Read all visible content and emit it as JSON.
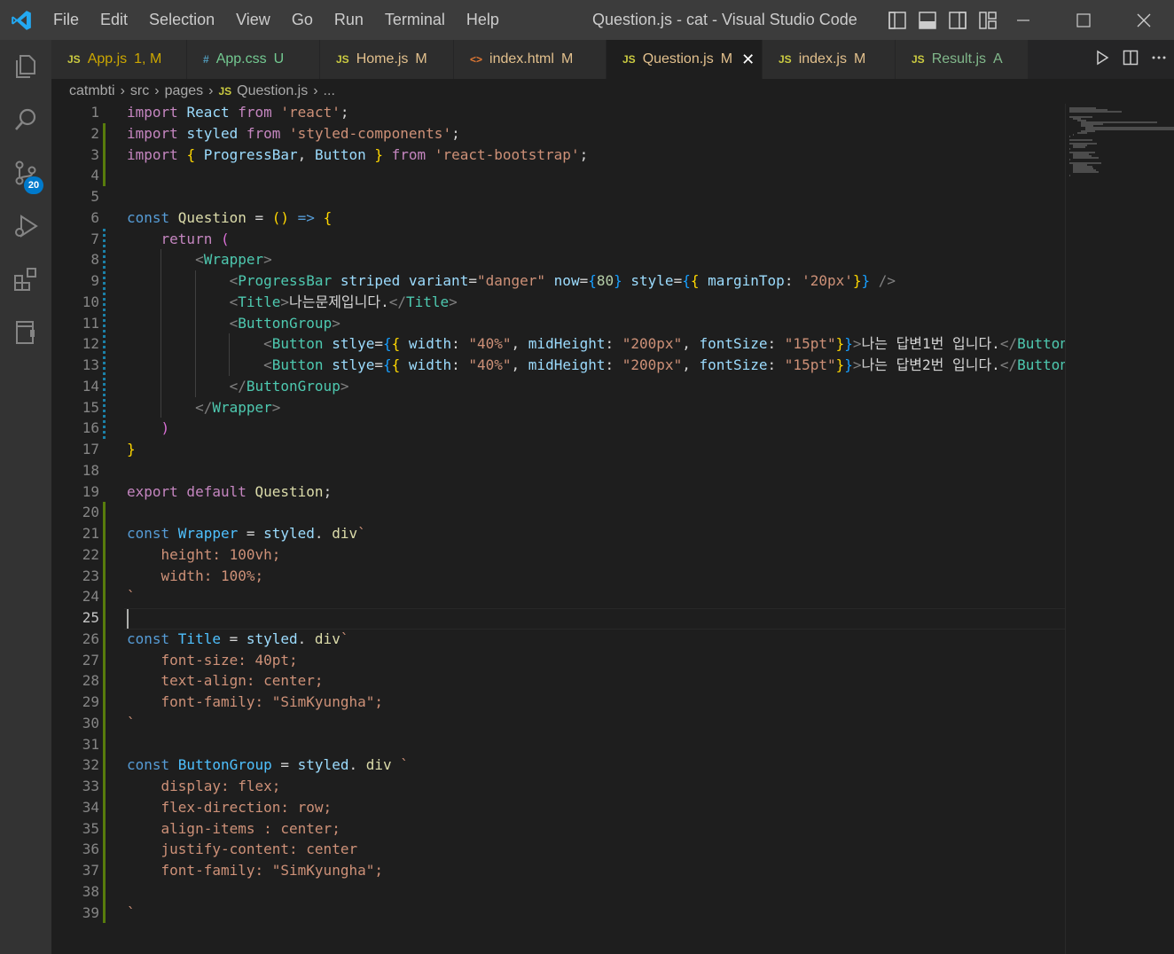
{
  "window": {
    "title": "Question.js - cat - Visual Studio Code",
    "menu": [
      "File",
      "Edit",
      "Selection",
      "View",
      "Go",
      "Run",
      "Terminal",
      "Help"
    ]
  },
  "activity": {
    "scm_badge": "20"
  },
  "tabs": [
    {
      "type": "JS",
      "type_color": "#cbcb41",
      "name": "App.js",
      "status": "1, M",
      "name_color": "#cca700",
      "active": false
    },
    {
      "type": "#",
      "type_color": "#519aba",
      "name": "App.css",
      "status": "U",
      "name_color": "#73c991",
      "active": false
    },
    {
      "type": "JS",
      "type_color": "#cbcb41",
      "name": "Home.js",
      "status": "M",
      "name_color": "#e2c08d",
      "active": false
    },
    {
      "type": "<>",
      "type_color": "#e37933",
      "name": "index.html",
      "status": "M",
      "name_color": "#e2c08d",
      "active": false
    },
    {
      "type": "JS",
      "type_color": "#cbcb41",
      "name": "Question.js",
      "status": "M",
      "name_color": "#e2c08d",
      "active": true,
      "close": "✕"
    },
    {
      "type": "JS",
      "type_color": "#cbcb41",
      "name": "index.js",
      "status": "M",
      "name_color": "#e2c08d",
      "active": false
    },
    {
      "type": "JS",
      "type_color": "#cbcb41",
      "name": "Result.js",
      "status": "A",
      "name_color": "#81b88b",
      "active": false
    }
  ],
  "breadcrumb": {
    "parts": [
      "catmbti",
      "src",
      "pages"
    ],
    "file_type": "JS",
    "file": "Question.js",
    "trail": "..."
  },
  "editor": {
    "current_line": 25,
    "lines": [
      [
        [
          "k",
          "import "
        ],
        [
          "v",
          "React "
        ],
        [
          "k",
          "from "
        ],
        [
          "s",
          "'react'"
        ],
        [
          "",
          "; "
        ]
      ],
      [
        [
          "k",
          "import "
        ],
        [
          "v",
          "styled "
        ],
        [
          "k",
          "from "
        ],
        [
          "s",
          "'styled-components'"
        ],
        [
          "",
          ";"
        ]
      ],
      [
        [
          "k",
          "import "
        ],
        [
          "p",
          "{ "
        ],
        [
          "v",
          "ProgressBar"
        ],
        [
          "",
          ", "
        ],
        [
          "v",
          "Button "
        ],
        [
          "p",
          "} "
        ],
        [
          "k",
          "from "
        ],
        [
          "s",
          "'react-bootstrap'"
        ],
        [
          "",
          ";"
        ]
      ],
      [],
      [],
      [
        [
          "b",
          "const "
        ],
        [
          "f",
          "Question "
        ],
        [
          "",
          "= "
        ],
        [
          "p",
          "() "
        ],
        [
          "b",
          "=> "
        ],
        [
          "p",
          "{"
        ]
      ],
      [
        [
          "",
          "    "
        ],
        [
          "k",
          "return "
        ],
        [
          "pm",
          "("
        ]
      ],
      [
        [
          "",
          "        "
        ],
        [
          "tg",
          "<"
        ],
        [
          "t",
          "Wrapper"
        ],
        [
          "tg",
          ">"
        ]
      ],
      [
        [
          "",
          "            "
        ],
        [
          "tg",
          "<"
        ],
        [
          "t",
          "ProgressBar "
        ],
        [
          "v",
          "striped variant"
        ],
        [
          "",
          "="
        ],
        [
          "s",
          "\"danger\" "
        ],
        [
          "v",
          "now"
        ],
        [
          "",
          "="
        ],
        [
          "pb",
          "{"
        ],
        [
          "n",
          "80"
        ],
        [
          "pb",
          "} "
        ],
        [
          "v",
          "style"
        ],
        [
          "",
          "="
        ],
        [
          "pb",
          "{"
        ],
        [
          "p",
          "{ "
        ],
        [
          "v",
          "marginTop"
        ],
        [
          "",
          ": "
        ],
        [
          "s",
          "'20px'"
        ],
        [
          "p",
          "}"
        ],
        [
          "pb",
          "} "
        ],
        [
          "tg",
          "/>"
        ]
      ],
      [
        [
          "",
          "            "
        ],
        [
          "tg",
          "<"
        ],
        [
          "t",
          "Title"
        ],
        [
          "tg",
          ">"
        ],
        [
          "",
          "나는문제입니다."
        ],
        [
          "tg",
          "</"
        ],
        [
          "t",
          "Title"
        ],
        [
          "tg",
          ">"
        ]
      ],
      [
        [
          "",
          "            "
        ],
        [
          "tg",
          "<"
        ],
        [
          "t",
          "ButtonGroup"
        ],
        [
          "tg",
          ">"
        ]
      ],
      [
        [
          "",
          "                "
        ],
        [
          "tg",
          "<"
        ],
        [
          "t",
          "Button "
        ],
        [
          "v",
          "stlye"
        ],
        [
          "",
          "="
        ],
        [
          "pb",
          "{"
        ],
        [
          "p",
          "{ "
        ],
        [
          "v",
          "width"
        ],
        [
          "",
          ": "
        ],
        [
          "s",
          "\"40%\""
        ],
        [
          "",
          ", "
        ],
        [
          "v",
          "midHeight"
        ],
        [
          "",
          ": "
        ],
        [
          "s",
          "\"200px\""
        ],
        [
          "",
          ", "
        ],
        [
          "v",
          "fontSize"
        ],
        [
          "",
          ": "
        ],
        [
          "s",
          "\"15pt\""
        ],
        [
          "p",
          "}"
        ],
        [
          "pb",
          "}"
        ],
        [
          "tg",
          ">"
        ],
        [
          "",
          "나는 답변1번 입니다."
        ],
        [
          "tg",
          "</"
        ],
        [
          "t",
          "Button"
        ],
        [
          "tg",
          ">"
        ]
      ],
      [
        [
          "",
          "                "
        ],
        [
          "tg",
          "<"
        ],
        [
          "t",
          "Button "
        ],
        [
          "v",
          "stlye"
        ],
        [
          "",
          "="
        ],
        [
          "pb",
          "{"
        ],
        [
          "p",
          "{ "
        ],
        [
          "v",
          "width"
        ],
        [
          "",
          ": "
        ],
        [
          "s",
          "\"40%\""
        ],
        [
          "",
          ", "
        ],
        [
          "v",
          "midHeight"
        ],
        [
          "",
          ": "
        ],
        [
          "s",
          "\"200px\""
        ],
        [
          "",
          ", "
        ],
        [
          "v",
          "fontSize"
        ],
        [
          "",
          ": "
        ],
        [
          "s",
          "\"15pt\""
        ],
        [
          "p",
          "}"
        ],
        [
          "pb",
          "}"
        ],
        [
          "tg",
          ">"
        ],
        [
          "",
          "나는 답변2번 입니다."
        ],
        [
          "tg",
          "</"
        ],
        [
          "t",
          "Button"
        ],
        [
          "tg",
          ">"
        ]
      ],
      [
        [
          "",
          "            "
        ],
        [
          "tg",
          "</"
        ],
        [
          "t",
          "ButtonGroup"
        ],
        [
          "tg",
          ">"
        ]
      ],
      [
        [
          "",
          "        "
        ],
        [
          "tg",
          "</"
        ],
        [
          "t",
          "Wrapper"
        ],
        [
          "tg",
          ">"
        ]
      ],
      [
        [
          "",
          "    "
        ],
        [
          "pm",
          ")"
        ]
      ],
      [
        [
          "p",
          "}"
        ]
      ],
      [],
      [
        [
          "k",
          "export default "
        ],
        [
          "f",
          "Question"
        ],
        [
          "",
          ";"
        ]
      ],
      [],
      [
        [
          "b",
          "const "
        ],
        [
          "cls",
          "Wrapper "
        ],
        [
          "",
          "= "
        ],
        [
          "v",
          "styled"
        ],
        [
          "",
          ". "
        ],
        [
          "f",
          "div"
        ],
        [
          "s",
          "`"
        ]
      ],
      [
        [
          "s",
          "    height: 100vh;"
        ]
      ],
      [
        [
          "s",
          "    width: 100%;"
        ]
      ],
      [
        [
          "s",
          "`"
        ]
      ],
      [],
      [
        [
          "b",
          "const "
        ],
        [
          "cls",
          "Title "
        ],
        [
          "",
          "= "
        ],
        [
          "v",
          "styled"
        ],
        [
          "",
          ". "
        ],
        [
          "f",
          "div"
        ],
        [
          "s",
          "`"
        ]
      ],
      [
        [
          "s",
          "    font-size: 40pt;"
        ]
      ],
      [
        [
          "s",
          "    text-align: center;"
        ]
      ],
      [
        [
          "s",
          "    font-family: \"SimKyungha\";"
        ]
      ],
      [
        [
          "s",
          "`"
        ]
      ],
      [],
      [
        [
          "b",
          "const "
        ],
        [
          "cls",
          "ButtonGroup "
        ],
        [
          "",
          "= "
        ],
        [
          "v",
          "styled"
        ],
        [
          "",
          ". "
        ],
        [
          "f",
          "div "
        ],
        [
          "s",
          "`"
        ]
      ],
      [
        [
          "s",
          "    display: flex;"
        ]
      ],
      [
        [
          "s",
          "    flex-direction: row;"
        ]
      ],
      [
        [
          "s",
          "    align-items : center;"
        ]
      ],
      [
        [
          "s",
          "    justify-content: center"
        ]
      ],
      [
        [
          "s",
          "    font-family: \"SimKyungha\";"
        ]
      ],
      [],
      [
        [
          "s",
          "`"
        ]
      ]
    ]
  }
}
